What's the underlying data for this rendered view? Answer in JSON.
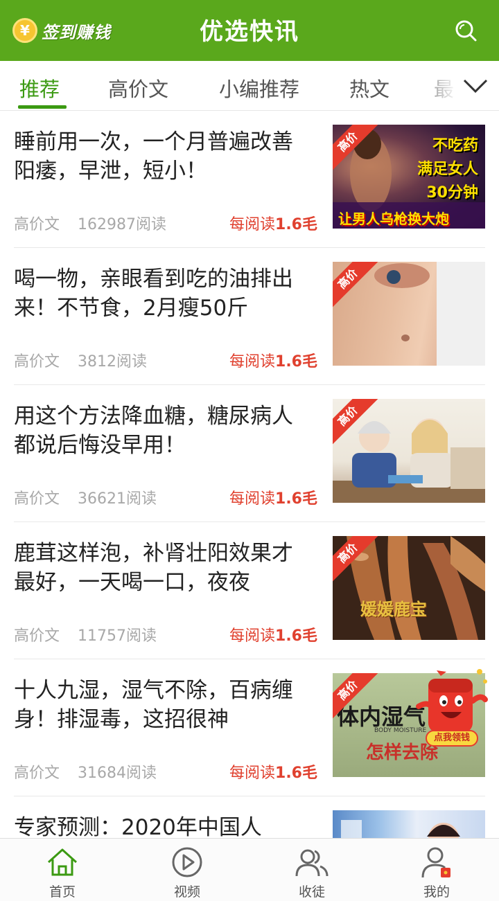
{
  "header": {
    "checkin_coin": "¥",
    "checkin_label": "签到赚钱",
    "title": "优选快讯",
    "search_icon": "search-icon",
    "brand_color": "#5aa81c"
  },
  "tabs": [
    {
      "label": "推荐",
      "active": true
    },
    {
      "label": "高价文",
      "active": false
    },
    {
      "label": "小编推荐",
      "active": false
    },
    {
      "label": "热文",
      "active": false
    },
    {
      "label": "最",
      "active": false
    }
  ],
  "tabs_more_icon": "chevron-down-icon",
  "articles": [
    {
      "title": "睡前用一次，一个月普遍改善阳痿，早泄，短小！",
      "source": "高价文",
      "reads": "162987阅读",
      "reward_prefix": "每阅读",
      "reward_value": "1.6毛",
      "badge": "高价",
      "thumb_text": [
        "不吃药",
        "满足女人",
        "30分钟",
        "让男人乌枪换大炮"
      ]
    },
    {
      "title": "喝一物，亲眼看到吃的油排出来！不节食，2月瘦50斤",
      "source": "高价文",
      "reads": "3812阅读",
      "reward_prefix": "每阅读",
      "reward_value": "1.6毛",
      "badge": "高价"
    },
    {
      "title": "用这个方法降血糖，糖尿病人都说后悔没早用！",
      "source": "高价文",
      "reads": "36621阅读",
      "reward_prefix": "每阅读",
      "reward_value": "1.6毛",
      "badge": "高价"
    },
    {
      "title": "鹿茸这样泡，补肾壮阳效果才最好，一天喝一口，夜夜",
      "source": "高价文",
      "reads": "11757阅读",
      "reward_prefix": "每阅读",
      "reward_value": "1.6毛",
      "badge": "高价",
      "thumb_text": [
        "媛媛鹿宝"
      ]
    },
    {
      "title": "十人九湿，湿气不除，百病缠身！排湿毒，这招很神",
      "source": "高价文",
      "reads": "31684阅读",
      "reward_prefix": "每阅读",
      "reward_value": "1.6毛",
      "badge": "高价",
      "thumb_text": [
        "体内湿气",
        "BODY MOISTURE",
        "怎样去除"
      ]
    },
    {
      "title": "专家预测：2020年中国人",
      "source": "",
      "reads": "",
      "reward_prefix": "",
      "reward_value": "",
      "badge": ""
    }
  ],
  "float_envelope": {
    "label": "点我领钱"
  },
  "bottom_nav": [
    {
      "label": "首页",
      "icon": "home-icon",
      "active": true
    },
    {
      "label": "视频",
      "icon": "video-play-icon",
      "active": false
    },
    {
      "label": "收徒",
      "icon": "users-icon",
      "active": false
    },
    {
      "label": "我的",
      "icon": "profile-icon",
      "active": false
    }
  ],
  "colors": {
    "accent": "#3b9a12",
    "reward": "#e0412f",
    "muted": "#a8a8a8"
  }
}
